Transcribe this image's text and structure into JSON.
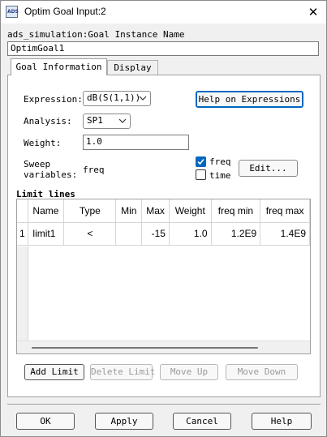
{
  "window": {
    "title": "Optim Goal Input:2",
    "icon_text": "ADS"
  },
  "instance": {
    "label": "ads_simulation:Goal Instance Name",
    "value": "OptimGoal1"
  },
  "tabs": [
    {
      "label": "Goal Information",
      "active": true
    },
    {
      "label": "Display",
      "active": false
    }
  ],
  "goal": {
    "expression_label": "Expression:",
    "expression_value": "dB(S(1,1))",
    "help_button": "Help on Expressions",
    "analysis_label": "Analysis:",
    "analysis_value": "SP1",
    "weight_label": "Weight:",
    "weight_value": "1.0",
    "sweep_label_line1": "Sweep",
    "sweep_label_line2": "variables:",
    "sweep_value": "freq",
    "sweep_options": [
      {
        "label": "freq",
        "checked": true
      },
      {
        "label": "time",
        "checked": false
      }
    ],
    "edit_button": "Edit..."
  },
  "limits": {
    "title": "Limit lines",
    "columns": [
      "Name",
      "Type",
      "Min",
      "Max",
      "Weight",
      "freq min",
      "freq max"
    ],
    "rows": [
      {
        "index": "1",
        "cells": [
          "limit1",
          "<",
          "",
          "-15",
          "1.0",
          "1.2E9",
          "1.4E9"
        ]
      }
    ],
    "buttons": {
      "add": "Add Limit",
      "delete": "Delete Limit",
      "up": "Move Up",
      "down": "Move Down"
    }
  },
  "footer": {
    "ok": "OK",
    "apply": "Apply",
    "cancel": "Cancel",
    "help": "Help"
  },
  "colors": {
    "accent": "#0067c0",
    "window_bg": "#f0f0f0",
    "scrollbar": "#767676"
  }
}
